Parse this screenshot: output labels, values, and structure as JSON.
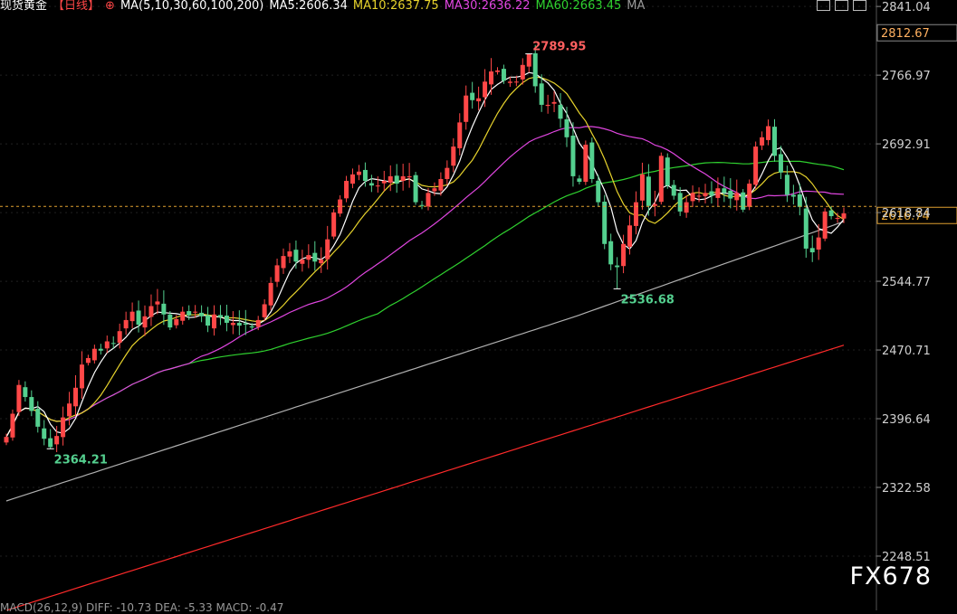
{
  "header": {
    "symbol": "现货黄金",
    "period": "【日线】",
    "ma_params": "MA(5,10,30,60,100,200)",
    "ma5": "MA5:2606.34",
    "ma10": "MA10:2637.75",
    "ma30": "MA30:2636.22",
    "ma60": "MA60:2663.45",
    "ma_extra": "MA"
  },
  "footer": {
    "macd": "MACD(26,12,9)  DIFF: -10.73  DEA: -5.33  MACD: -0.47"
  },
  "watermark": "FX678",
  "colors": {
    "up": "#ff4747",
    "down": "#54d08f",
    "ma5": "#ffffff",
    "ma10": "#e6d22c",
    "ma30": "#e046e0",
    "ma60": "#2fd12f",
    "ma100": "#b0b0b0",
    "ma200": "#ff2a2a",
    "current_line": "#e0a030"
  },
  "chart_data": {
    "type": "candlestick",
    "y_ticks": [
      "2841.04",
      "2766.97",
      "2692.91",
      "2618.84",
      "2544.77",
      "2470.71",
      "2396.64",
      "2322.58",
      "2248.51"
    ],
    "high_label": "2812.67",
    "current_price_label": "2616.74",
    "annotations": [
      {
        "text": "2789.95",
        "value": 2789.95
      },
      {
        "text": "2536.68",
        "value": 2536.68
      },
      {
        "text": "2364.21",
        "value": 2364.21
      }
    ],
    "ylim": [
      2190,
      2848
    ],
    "closes": [
      2377,
      2402,
      2433,
      2420,
      2405,
      2388,
      2375,
      2366,
      2378,
      2398,
      2413,
      2430,
      2455,
      2462,
      2472,
      2470,
      2480,
      2478,
      2491,
      2503,
      2512,
      2498,
      2507,
      2518,
      2523,
      2509,
      2495,
      2504,
      2512,
      2508,
      2512,
      2507,
      2497,
      2509,
      2506,
      2500,
      2500,
      2497,
      2498,
      2495,
      2503,
      2520,
      2543,
      2562,
      2572,
      2577,
      2566,
      2568,
      2573,
      2566,
      2568,
      2590,
      2619,
      2633,
      2653,
      2660,
      2663,
      2653,
      2648,
      2648,
      2653,
      2658,
      2650,
      2658,
      2658,
      2630,
      2626,
      2640,
      2645,
      2655,
      2667,
      2690,
      2716,
      2745,
      2740,
      2742,
      2760,
      2771,
      2772,
      2761,
      2760,
      2760,
      2778,
      2790,
      2755,
      2735,
      2735,
      2738,
      2720,
      2700,
      2658,
      2652,
      2692,
      2655,
      2630,
      2585,
      2563,
      2560,
      2585,
      2605,
      2630,
      2660,
      2626,
      2628,
      2680,
      2648,
      2637,
      2620,
      2630,
      2640,
      2637,
      2640,
      2637,
      2645,
      2640,
      2634,
      2640,
      2622,
      2650,
      2690,
      2700,
      2712,
      2680,
      2662,
      2638,
      2636,
      2625,
      2580,
      2576,
      2592,
      2620,
      2615,
      2613,
      2618
    ],
    "ma5_last": 2606.34,
    "ma10_last": 2637.75,
    "ma30_last": 2636.22,
    "ma60_last": 2663.45
  }
}
